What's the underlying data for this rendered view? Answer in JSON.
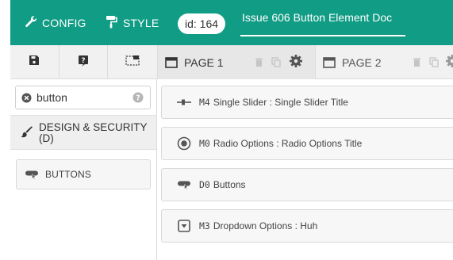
{
  "topbar": {
    "config_label": "CONFIG",
    "style_label": "STYLE",
    "id_label": "id: 164",
    "doc_title": "Issue 606 Button Element Doc"
  },
  "tabs": [
    {
      "label": "PAGE 1",
      "active": true
    },
    {
      "label": "PAGE 2",
      "active": false
    }
  ],
  "sidebar": {
    "search_value": "button",
    "category_label": "DESIGN & SECURITY (D)",
    "widgets": [
      {
        "label": "BUTTONS",
        "icon": "button-icon"
      }
    ]
  },
  "elements": [
    {
      "code": "M4",
      "title": "Single Slider : Single Slider Title",
      "icon": "slider-icon"
    },
    {
      "code": "M0",
      "title": "Radio Options : Radio Options Title",
      "icon": "radio-icon"
    },
    {
      "code": "D0",
      "title": "Buttons",
      "icon": "button-icon"
    },
    {
      "code": "M3",
      "title": "Dropdown Options : Huh",
      "icon": "dropdown-icon"
    }
  ],
  "colors": {
    "accent": "#119c85",
    "tab_active_bg": "#e7e7e7",
    "panel_bg": "#f1f1f1"
  }
}
